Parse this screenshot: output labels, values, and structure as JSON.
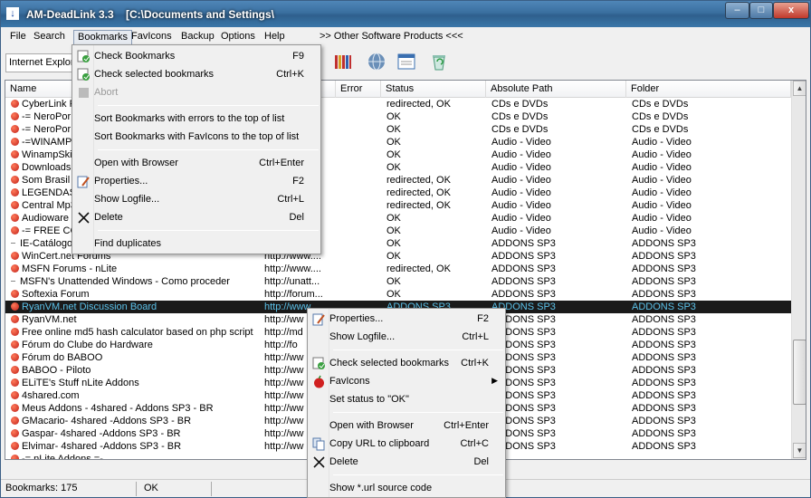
{
  "window": {
    "title": "AM-DeadLink 3.3",
    "path": "[C:\\Documents and Settings\\"
  },
  "window_buttons": {
    "minimize": "–",
    "maximize": "□",
    "close": "x"
  },
  "menubar": {
    "items": [
      "File",
      "Search",
      "Bookmarks",
      "FavIcons",
      "Backup",
      "Options",
      "Help"
    ],
    "other_products": ">> Other Software Products <<<"
  },
  "toolbar": {
    "browser_combo": "Internet Explorer"
  },
  "columns": [
    "Name",
    "",
    "Error",
    "Status",
    "Absolute Path",
    "Folder"
  ],
  "rows": [
    {
      "name": "CyberLink P",
      "url": "",
      "status": "redirected, OK",
      "path": "CDs e DVDs",
      "folder": "CDs e DVDs",
      "icon": "apple"
    },
    {
      "name": "-= NeroPor",
      "url": "",
      "status": "OK",
      "path": "CDs e DVDs",
      "folder": "CDs e DVDs",
      "icon": "apple"
    },
    {
      "name": "-= NeroPor",
      "url": "",
      "status": "OK",
      "path": "CDs e DVDs",
      "folder": "CDs e DVDs",
      "icon": "apple"
    },
    {
      "name": "-=WINAMP",
      "url": "",
      "status": "OK",
      "path": "Audio - Video",
      "folder": "Audio - Video",
      "icon": "apple"
    },
    {
      "name": "WinampSkin",
      "url": "",
      "status": "OK",
      "path": "Audio - Video",
      "folder": "Audio - Video",
      "icon": "apple"
    },
    {
      "name": "Downloads",
      "url": "",
      "status": "OK",
      "path": "Audio - Video",
      "folder": "Audio - Video",
      "icon": "apple"
    },
    {
      "name": "Som Brasil",
      "url": "",
      "status": "redirected, OK",
      "path": "Audio - Video",
      "folder": "Audio - Video",
      "icon": "apple"
    },
    {
      "name": "LEGENDAS.",
      "url": "",
      "status": "redirected, OK",
      "path": "Audio - Video",
      "folder": "Audio - Video",
      "icon": "apple"
    },
    {
      "name": "Central Mp3",
      "url": "",
      "status": "redirected, OK",
      "path": "Audio - Video",
      "folder": "Audio - Video",
      "icon": "apple"
    },
    {
      "name": "Audioware E",
      "url": "",
      "status": "OK",
      "path": "Audio - Video",
      "folder": "Audio - Video",
      "icon": "apple"
    },
    {
      "name": "-= FREE CO",
      "url": "",
      "status": "OK",
      "path": "Audio - Video",
      "folder": "Audio - Video",
      "icon": "apple"
    },
    {
      "name": "IE-Catálogo",
      "url": "",
      "status": "OK",
      "path": "ADDONS SP3",
      "folder": "ADDONS SP3",
      "icon": "doc"
    },
    {
      "name": "WinCert.net Forums",
      "url": "http://www....",
      "status": "OK",
      "path": "ADDONS SP3",
      "folder": "ADDONS SP3",
      "icon": "apple"
    },
    {
      "name": "MSFN Forums - nLite",
      "url": "http://www....",
      "status": "redirected, OK",
      "path": "ADDONS SP3",
      "folder": "ADDONS SP3",
      "icon": "apple"
    },
    {
      "name": "MSFN's Unattended Windows - Como proceder",
      "url": "http://unatt...",
      "status": "OK",
      "path": "ADDONS SP3",
      "folder": "ADDONS SP3",
      "icon": "doc"
    },
    {
      "name": "Softexia Forum",
      "url": "http://forum...",
      "status": "OK",
      "path": "ADDONS SP3",
      "folder": "ADDONS SP3",
      "icon": "apple"
    },
    {
      "name": "RyanVM.net Discussion Board",
      "url": "http://www",
      "status": "ADDONS SP3",
      "path": "ADDONS SP3",
      "folder": "ADDONS SP3",
      "icon": "apple",
      "selected": true
    },
    {
      "name": "RyanVM.net",
      "url": "http://ww",
      "status": "",
      "path": "ADDONS SP3",
      "folder": "ADDONS SP3",
      "icon": "apple"
    },
    {
      "name": "Free online md5 hash calculator based on php script",
      "url": "http://md",
      "status": "",
      "path": "ADDONS SP3",
      "folder": "ADDONS SP3",
      "icon": "apple"
    },
    {
      "name": "Fórum do Clube do Hardware",
      "url": "http://fo",
      "status": "",
      "path": "ADDONS SP3",
      "folder": "ADDONS SP3",
      "icon": "apple"
    },
    {
      "name": "Fórum do BABOO",
      "url": "http://ww",
      "status": "",
      "path": "ADDONS SP3",
      "folder": "ADDONS SP3",
      "icon": "apple"
    },
    {
      "name": "BABOO - Piloto",
      "url": "http://ww",
      "status": "",
      "path": "ADDONS SP3",
      "folder": "ADDONS SP3",
      "icon": "apple"
    },
    {
      "name": "ELiTE's Stuff nLite Addons",
      "url": "http://ww",
      "status": "",
      "path": "ADDONS SP3",
      "folder": "ADDONS SP3",
      "icon": "apple"
    },
    {
      "name": "4shared.com",
      "url": "http://ww",
      "status": "",
      "path": "ADDONS SP3",
      "folder": "ADDONS SP3",
      "icon": "apple"
    },
    {
      "name": "Meus Addons - 4shared - Addons SP3 - BR",
      "url": "http://ww",
      "status": "",
      "path": "ADDONS SP3",
      "folder": "ADDONS SP3",
      "icon": "apple"
    },
    {
      "name": "GMacario- 4shared -Addons SP3 - BR",
      "url": "http://ww",
      "status": "",
      "path": "ADDONS SP3",
      "folder": "ADDONS SP3",
      "icon": "apple"
    },
    {
      "name": "Gaspar- 4shared -Addons SP3 - BR",
      "url": "http://ww",
      "status": "",
      "path": "ADDONS SP3",
      "folder": "ADDONS SP3",
      "icon": "apple"
    },
    {
      "name": "Elvimar- 4shared -Addons SP3 - BR",
      "url": "http://ww",
      "status": "",
      "path": "ADDONS SP3",
      "folder": "ADDONS SP3",
      "icon": "apple"
    },
    {
      "name": "-= nLite Addons =-",
      "url": "",
      "status": "",
      "path": "",
      "folder": "",
      "icon": "apple"
    }
  ],
  "bookmarks_menu": {
    "items": [
      {
        "label": "Check Bookmarks",
        "shortcut": "F9"
      },
      {
        "label": "Check selected bookmarks",
        "shortcut": "Ctrl+K"
      },
      {
        "label": "Abort",
        "shortcut": ""
      },
      {
        "label": "Sort Bookmarks with errors to the top of list",
        "shortcut": ""
      },
      {
        "label": "Sort Bookmarks with FavIcons to the top of list",
        "shortcut": ""
      },
      {
        "label": "Open with Browser",
        "shortcut": "Ctrl+Enter"
      },
      {
        "label": "Properties...",
        "shortcut": "F2"
      },
      {
        "label": "Show Logfile...",
        "shortcut": "Ctrl+L"
      },
      {
        "label": "Delete",
        "shortcut": "Del"
      },
      {
        "label": "Find duplicates",
        "shortcut": ""
      }
    ]
  },
  "context_menu": {
    "items": [
      {
        "label": "Properties...",
        "shortcut": "F2"
      },
      {
        "label": "Show Logfile...",
        "shortcut": "Ctrl+L"
      },
      {
        "label": "Check selected bookmarks",
        "shortcut": "Ctrl+K"
      },
      {
        "label": "FavIcons",
        "shortcut": ""
      },
      {
        "label": "Set status to \"OK\"",
        "shortcut": ""
      },
      {
        "label": "Open with Browser",
        "shortcut": "Ctrl+Enter"
      },
      {
        "label": "Copy URL to clipboard",
        "shortcut": "Ctrl+C"
      },
      {
        "label": "Delete",
        "shortcut": "Del"
      },
      {
        "label": "Show *.url source code",
        "shortcut": ""
      }
    ]
  },
  "statusbar": {
    "count": "Bookmarks: 175",
    "state": "OK"
  },
  "colors": {
    "titlebar": "#3a6f9f",
    "selection": "#1a1a1a",
    "selection_text": "#5bc0e8"
  }
}
